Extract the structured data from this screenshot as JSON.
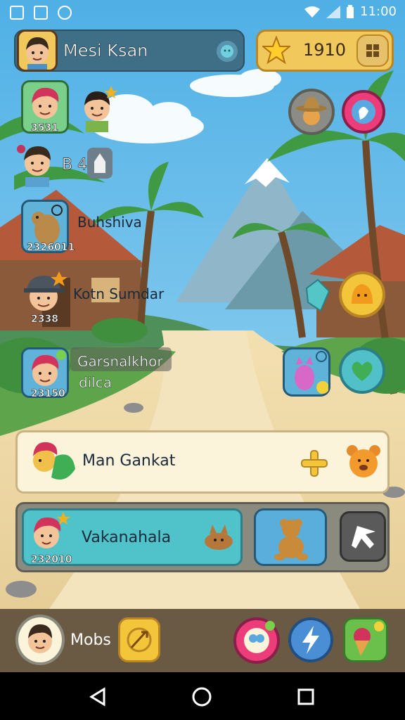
{
  "status_bar": {
    "time": "11:00"
  },
  "player": {
    "name": "Mesi Ksan"
  },
  "currency": {
    "coins": "1910"
  },
  "left_column": [
    {
      "number": "3531"
    },
    {
      "text": "B 40"
    },
    {
      "name": "Buhshiva",
      "number": "2326011"
    },
    {
      "name": "Kotn Sumdar",
      "number": "2338"
    },
    {
      "name_line1": "Garsnalkhor",
      "name_line2": "dilca",
      "number": "23150"
    }
  ],
  "quest_card": {
    "title": "Man Gankat"
  },
  "feature_card": {
    "title": "Vakanahala",
    "number": "232010"
  },
  "bottom_bar": {
    "label": "Mobs"
  },
  "colors": {
    "sky": "#6ec0ea",
    "sand": "#f1dcaa",
    "panel_blue": "#3f6f86",
    "gold": "#f1c85b",
    "teal": "#4fc3c9",
    "bar": "#6b5a43"
  },
  "icons": [
    "star-icon",
    "grid-icon",
    "cowboy-hat-icon",
    "chat-bubble-icon",
    "potion-icon",
    "slime-icon",
    "heart-icon",
    "plus-icon",
    "bear-icon",
    "fox-icon",
    "arrow-icon",
    "sword-icon",
    "cat-icon",
    "lightning-icon",
    "flower-icon",
    "back-icon",
    "home-icon",
    "recents-icon",
    "wifi-icon",
    "signal-icon",
    "battery-icon"
  ]
}
